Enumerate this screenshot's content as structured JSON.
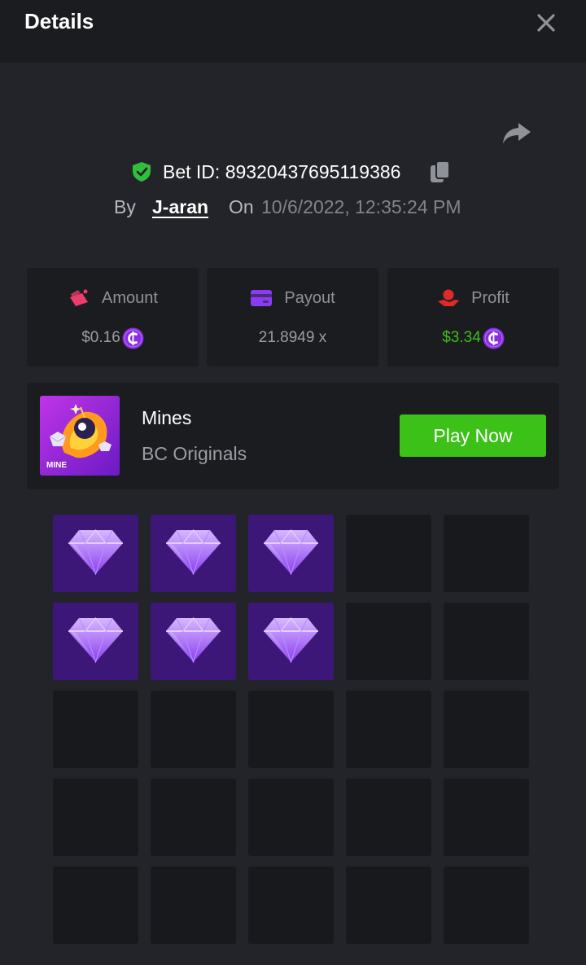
{
  "header": {
    "title": "Details"
  },
  "bet": {
    "id_label": "Bet ID: 89320437695119386",
    "by_label": "By",
    "user": "J-aran",
    "on_label": "On",
    "date": "10/6/2022, 12:35:24 PM"
  },
  "stats": [
    {
      "label": "Amount",
      "value": "$0.16",
      "value_color": "#9a9da3",
      "icon": "amount-icon",
      "icon_color": "#ec3c6b"
    },
    {
      "label": "Payout",
      "value": "21.8949 x",
      "value_color": "#9a9da3",
      "icon": "payout-card-icon",
      "icon_color": "#8b3cf0"
    },
    {
      "label": "Profit",
      "value": "$3.34",
      "value_color": "#3bc117",
      "icon": "profit-hand-icon",
      "icon_color": "#e02a2a"
    }
  ],
  "game": {
    "name": "Mines",
    "provider": "BC Originals",
    "play_label": "Play Now",
    "thumb_label": "MINE"
  },
  "board": {
    "rows": 5,
    "cols": 5,
    "cells": [
      "gem",
      "gem",
      "gem",
      "empty",
      "empty",
      "gem",
      "gem",
      "gem",
      "empty",
      "empty",
      "empty",
      "empty",
      "empty",
      "empty",
      "empty",
      "empty",
      "empty",
      "empty",
      "empty",
      "empty",
      "empty",
      "empty",
      "empty",
      "empty",
      "empty"
    ]
  },
  "colors": {
    "accent_green": "#3bc117",
    "gem_tile": "#3c1778",
    "empty_tile": "#18191c",
    "coin": "#8b2be2"
  }
}
